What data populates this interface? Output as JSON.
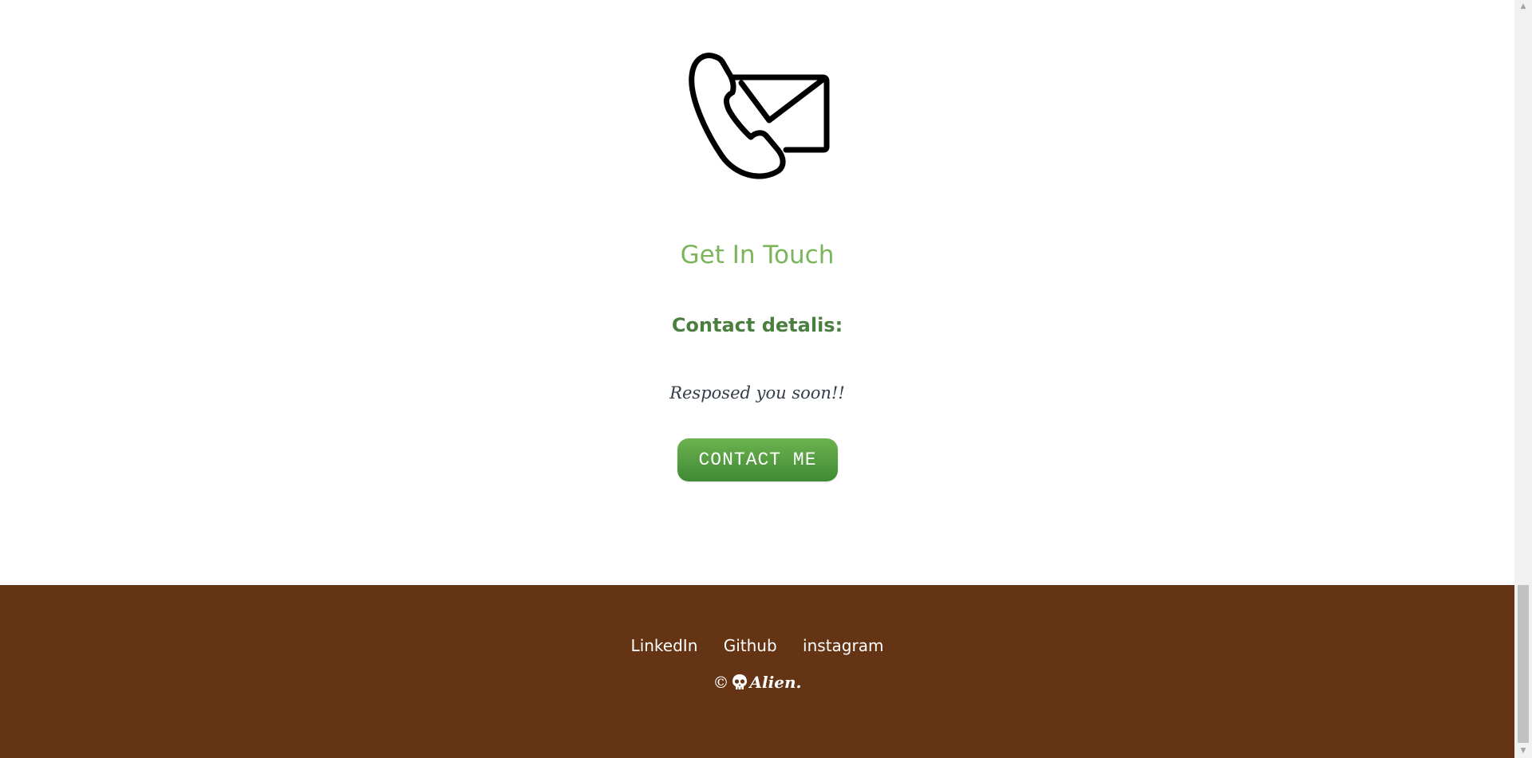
{
  "contact": {
    "icon": "phone-envelope-icon",
    "title": "Get In Touch",
    "subtitle": "Contact detalis:",
    "note": "Resposed you soon!!",
    "button_label": "CONTACT ME"
  },
  "footer": {
    "links": [
      "LinkedIn",
      "Github",
      "instagram"
    ],
    "copyright_symbol": "©",
    "copyright_icon": "skull-icon",
    "copyright_name": "Alien."
  },
  "scrollbar": {
    "up_arrow": "▲",
    "down_arrow": "▼"
  },
  "colors": {
    "title": "#7ab55c",
    "subtitle": "#4b7f3f",
    "button": "#4f9a3e",
    "footer_bg": "#643414"
  }
}
